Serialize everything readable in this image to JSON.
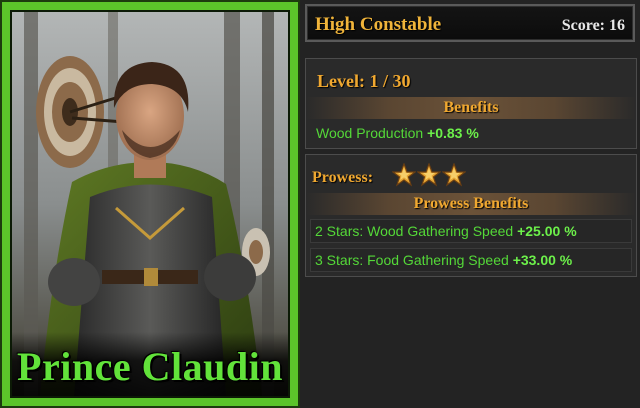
{
  "hero": {
    "name": "Prince Claudin",
    "frame_color": "#5cc42a",
    "name_color": "#62e33a"
  },
  "header": {
    "title": "High Constable",
    "score": "Score: 16"
  },
  "level": {
    "text": "Level: 1 / 30",
    "benefits_header": "Benefits",
    "benefits": [
      {
        "label": "Wood Production",
        "value": "+0.83 %"
      }
    ]
  },
  "prowess": {
    "label": "Prowess:",
    "stars": 3,
    "header": "Prowess Benefits",
    "benefits": [
      {
        "label": "2 Stars: Wood Gathering Speed",
        "value": "+25.00 %"
      },
      {
        "label": "3 Stars: Food Gathering Speed",
        "value": "+33.00 %"
      }
    ]
  },
  "colors": {
    "accent_gold": "#f0a830",
    "benefit_green": "#54d838",
    "background": "#232323"
  }
}
